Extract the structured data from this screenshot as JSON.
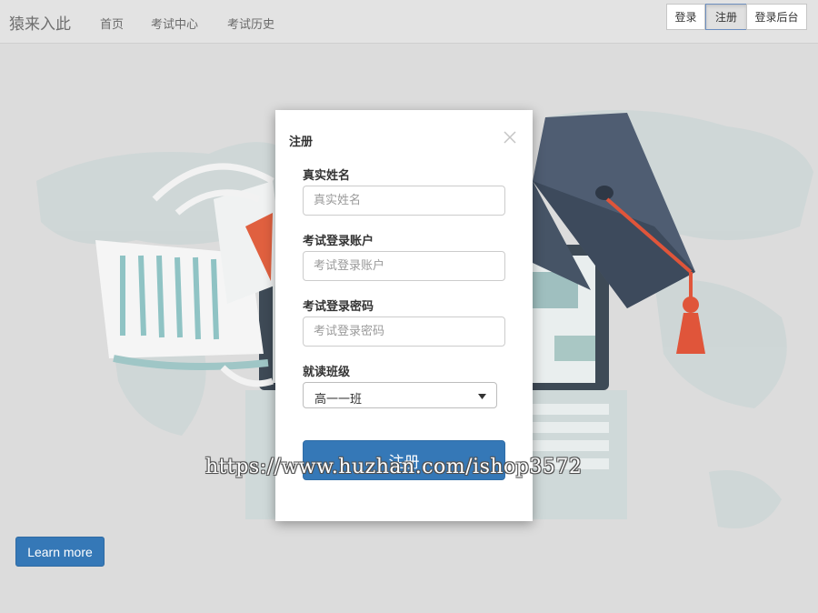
{
  "navbar": {
    "brand": "猿来入此",
    "links": [
      "首页",
      "考试中心",
      "考试历史"
    ],
    "buttons": {
      "login": "登录",
      "register": "注册",
      "admin_login": "登录后台"
    }
  },
  "hero": {
    "learn_more": "Learn more"
  },
  "modal": {
    "title": "注册",
    "fields": [
      {
        "label": "真实姓名",
        "placeholder": "真实姓名"
      },
      {
        "label": "考试登录账户",
        "placeholder": "考试登录账户"
      },
      {
        "label": "考试登录密码",
        "placeholder": "考试登录密码"
      }
    ],
    "class_field": {
      "label": "就读班级",
      "selected": "高一一班"
    },
    "submit": "注册"
  },
  "watermark": "https://www.huzhan.com/ishop3572",
  "colors": {
    "primary": "#3578b7",
    "navbar_bg": "#e3e3e3",
    "page_bg": "#dcdcdc",
    "tassel": "#e0553a",
    "cap": "#4a5a70"
  }
}
